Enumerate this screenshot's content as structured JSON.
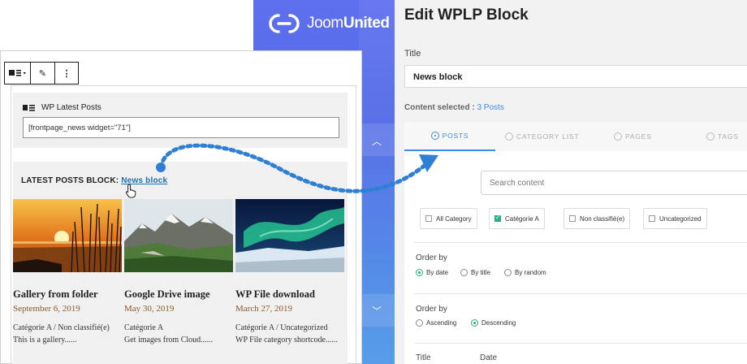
{
  "brand": {
    "name_light": "Joom",
    "name_bold": "United"
  },
  "panel": {
    "title": "Edit WPLP Block",
    "title_label": "Title",
    "title_value": "News block",
    "content_selected_label": "Content selected : ",
    "content_selected_count": "3 Posts",
    "tabs": [
      {
        "label": "POSTS",
        "active": true
      },
      {
        "label": "CATEGORY LIST",
        "active": false
      },
      {
        "label": "PAGES",
        "active": false
      },
      {
        "label": "TAGS",
        "active": false
      }
    ],
    "search_placeholder": "Search content",
    "categories": [
      {
        "label": "All Category",
        "checked": false
      },
      {
        "label": "Catégorie A",
        "checked": true
      },
      {
        "label": "Non classifié(e)",
        "checked": false
      },
      {
        "label": "Uncategorized",
        "checked": false
      }
    ],
    "order_by_label": "Order by",
    "order_by_options": [
      {
        "label": "By date",
        "selected": true
      },
      {
        "label": "By title",
        "selected": false
      },
      {
        "label": "By random",
        "selected": false
      }
    ],
    "order_dir_label": "Order by",
    "order_dir_options": [
      {
        "label": "Ascending",
        "selected": false
      },
      {
        "label": "Descending",
        "selected": true
      }
    ],
    "columns": [
      "Title",
      "Date"
    ]
  },
  "editor": {
    "toolbar": {
      "block_icon": "block-list-icon",
      "edit_icon": "pencil-icon",
      "more_icon": "more-vertical-icon"
    },
    "shortcode_title": "WP Latest Posts",
    "shortcode_value": "[frontpage_news widget=\"71\"]",
    "latest_label": "LATEST POSTS BLOCK: ",
    "latest_link": "News block",
    "posts": [
      {
        "title": "Gallery from folder",
        "date": "September 6, 2019",
        "category": "Catégorie A / Non classifié(e)",
        "excerpt": "This is a gallery......"
      },
      {
        "title": "Google Drive image",
        "date": "May 30, 2019",
        "category": "Catégorie A",
        "excerpt": "Get images from Cloud......"
      },
      {
        "title": "WP File download",
        "date": "March 27, 2019",
        "category": "Catégorie A / Uncategorized",
        "excerpt": "WP File category shortcode......"
      }
    ]
  },
  "colors": {
    "accent": "#3b8de0",
    "check": "#27ae86",
    "sidebar": "#4f68e6",
    "link": "#2271b1"
  }
}
